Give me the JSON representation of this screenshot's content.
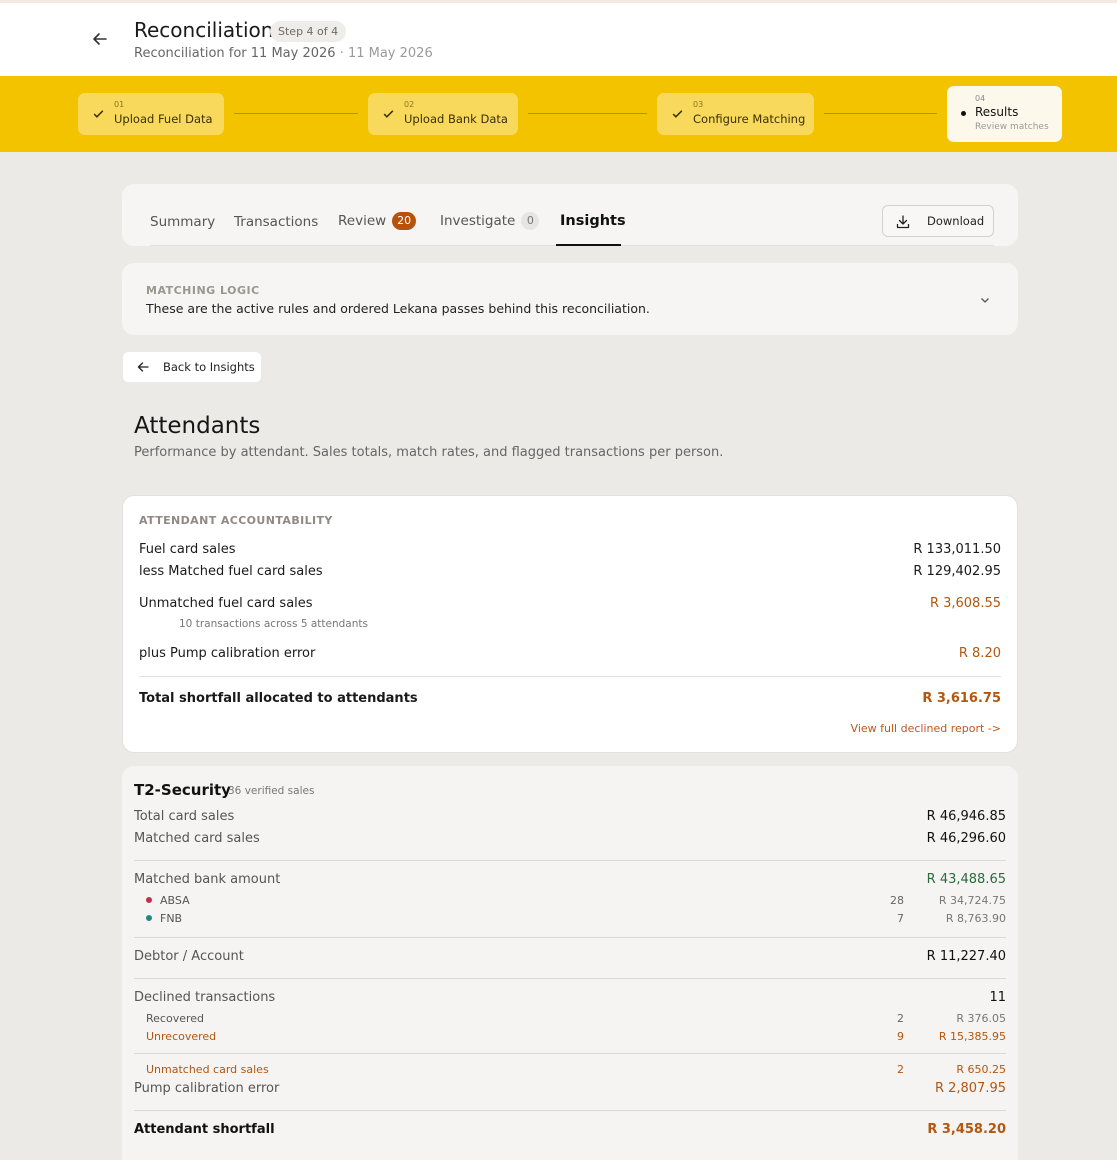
{
  "header": {
    "title": "Reconciliation",
    "step_pill": "Step 4 of 4",
    "subtitle": "Reconciliation for 11 May 2026",
    "subtitle_date": "· 11 May 2026"
  },
  "stepper": {
    "steps": [
      {
        "num": "01",
        "label": "Upload Fuel Data",
        "state": "done"
      },
      {
        "num": "02",
        "label": "Upload Bank Data",
        "state": "done"
      },
      {
        "num": "03",
        "label": "Configure Matching",
        "state": "done"
      },
      {
        "num": "04",
        "label": "Results",
        "sub": "Review matches",
        "state": "active"
      }
    ]
  },
  "tabs": {
    "summary": "Summary",
    "transactions": "Transactions",
    "review": "Review",
    "review_count": "20",
    "investigate": "Investigate",
    "investigate_count": "0",
    "insights": "Insights",
    "download": "Download",
    "active_tab": "Insights"
  },
  "matching_logic": {
    "title": "MATCHING LOGIC",
    "text": "These are the active rules and ordered Lekana passes behind this reconciliation."
  },
  "back_button": "Back to Insights",
  "page": {
    "title": "Attendants",
    "subtitle": "Performance by attendant. Sales totals, match rates, and flagged transactions per person."
  },
  "accountability": {
    "title": "ATTENDANT ACCOUNTABILITY",
    "fuel_card_sales_label": "Fuel card sales",
    "fuel_card_sales": "R 133,011.50",
    "matched_label": "less Matched fuel card sales",
    "matched": "R 129,402.95",
    "unmatched_label": "Unmatched fuel card sales",
    "unmatched": "R 3,608.55",
    "unmatched_note": "10 transactions across 5 attendants",
    "pump_label": "plus Pump calibration error",
    "pump": "R 8.20",
    "total_label": "Total shortfall allocated to attendants",
    "total": "R 3,616.75",
    "link": "View full declined report ->"
  },
  "attendant": {
    "name": "T2-Security",
    "meta": "36 verified sales",
    "total_card_sales_label": "Total card sales",
    "total_card_sales": "R 46,946.85",
    "matched_card_sales_label": "Matched card sales",
    "matched_card_sales": "R 46,296.60",
    "matched_bank_label": "Matched bank amount",
    "matched_bank": "R 43,488.65",
    "banks": [
      {
        "name": "ABSA",
        "count": "28",
        "amount": "R 34,724.75",
        "color": "#c0304a"
      },
      {
        "name": "FNB",
        "count": "7",
        "amount": "R 8,763.90",
        "color": "#1f8a82"
      }
    ],
    "debtor_label": "Debtor / Account",
    "debtor": "R 11,227.40",
    "declined_label": "Declined transactions",
    "declined": "11",
    "recovered_label": "Recovered",
    "recovered_count": "2",
    "recovered": "R 376.05",
    "unrecovered_label": "Unrecovered",
    "unrecovered_count": "9",
    "unrecovered": "R 15,385.95",
    "unmatched_label": "Unmatched card sales",
    "unmatched_count": "2",
    "unmatched": "R 650.25",
    "pump_label": "Pump calibration error",
    "pump": "R 2,807.95",
    "shortfall_label": "Attendant shortfall",
    "shortfall": "R 3,458.20"
  },
  "colors": {
    "stepper_bg": "#f3c300",
    "accent_orange": "#b3560e",
    "badge": "#b8520a",
    "green": "#2a6b40"
  },
  "icons": [
    "arrow-left-icon",
    "check-icon",
    "download-icon",
    "chevron-down-icon"
  ]
}
